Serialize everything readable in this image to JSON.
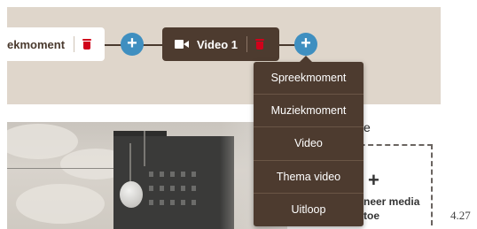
{
  "timeline": {
    "nodes": [
      {
        "label": "ekmoment",
        "style": "light"
      },
      {
        "label": "Video 1",
        "style": "dark"
      }
    ],
    "add_symbol": "+"
  },
  "menu": {
    "items": [
      "Spreekmoment",
      "Muziekmoment",
      "Video",
      "Thema video",
      "Uitloop"
    ]
  },
  "preview": {
    "title_fragment": "e",
    "add_media_plus": "+",
    "add_media_label": "neer media toe"
  },
  "page_number": "4.27",
  "colors": {
    "band": "#dfd6cb",
    "dark_node": "#4d3b2f",
    "plus_button": "#3f8fc0",
    "delete_icon": "#d0021b"
  }
}
